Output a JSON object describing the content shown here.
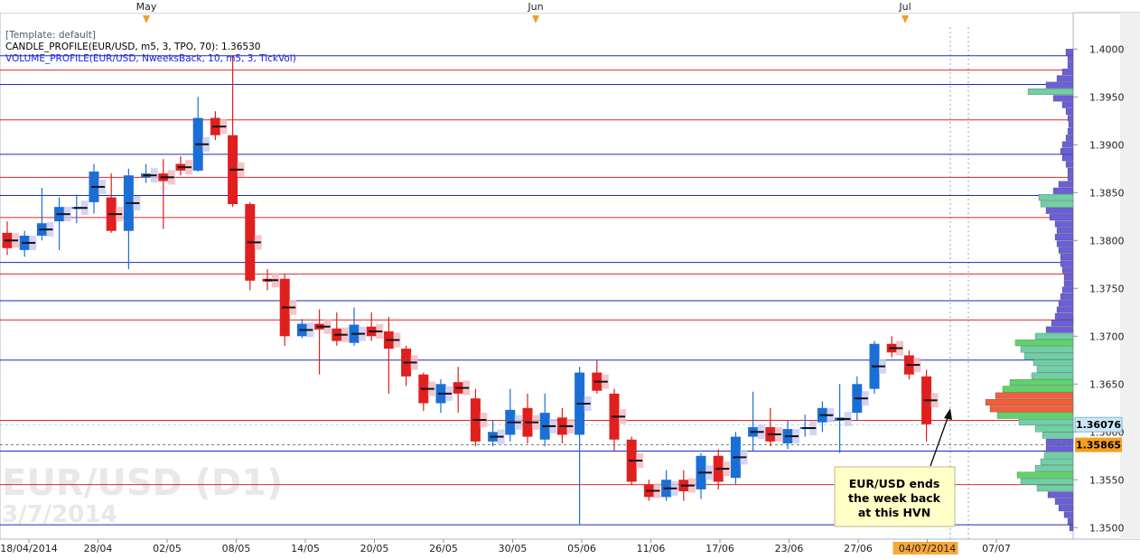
{
  "chart_data": {
    "type": "candlestick",
    "symbol_watermark": "EUR/USD (D1)",
    "date_watermark": "3/7/2014",
    "template_label": "[Template: default]",
    "indicator_1": "CANDLE_PROFILE(EUR/USD, m5, 3, TPO, 70): 1.36530",
    "indicator_2": "VOLUME_PROFILE(EUR/USD, NweeksBack, 10, m5, 3, TickVol)",
    "ylim": [
      1.3488,
      1.4038
    ],
    "y_ticks": [
      "1.4000",
      "1.3950",
      "1.3900",
      "1.3850",
      "1.3800",
      "1.3750",
      "1.3700",
      "1.3650",
      "1.3600",
      "1.3550",
      "1.3500"
    ],
    "months": [
      "May",
      "Jun",
      "Jul"
    ],
    "x_labels": [
      "18/04/2014",
      "28/04",
      "02/05",
      "08/05",
      "14/05",
      "20/05",
      "26/05",
      "30/05",
      "05/06",
      "11/06",
      "17/06",
      "23/06",
      "27/06",
      "04/07/2014",
      "07/07"
    ],
    "current_price": "1.36076",
    "marker_price": "1.35865",
    "current_price_value": 1.36076,
    "marker_price_value": 1.35865,
    "red_levels": [
      1.3978,
      1.3926,
      1.3866,
      1.3824,
      1.3765,
      1.3717,
      1.3612,
      1.3545
    ],
    "blue_levels": [
      1.3993,
      1.3963,
      1.389,
      1.3847,
      1.3777,
      1.3737,
      1.3675,
      1.358,
      1.3503
    ],
    "candles": [
      {
        "o": 1.3808,
        "h": 1.382,
        "l": 1.3785,
        "c": 1.3792
      },
      {
        "o": 1.379,
        "h": 1.381,
        "l": 1.3783,
        "c": 1.3805
      },
      {
        "o": 1.3805,
        "h": 1.3855,
        "l": 1.38,
        "c": 1.3818
      },
      {
        "o": 1.382,
        "h": 1.3845,
        "l": 1.379,
        "c": 1.3835
      },
      {
        "o": 1.3833,
        "h": 1.3848,
        "l": 1.3818,
        "c": 1.3835
      },
      {
        "o": 1.384,
        "h": 1.388,
        "l": 1.3828,
        "c": 1.3872
      },
      {
        "o": 1.3845,
        "h": 1.387,
        "l": 1.3808,
        "c": 1.381
      },
      {
        "o": 1.381,
        "h": 1.3875,
        "l": 1.377,
        "c": 1.3868
      },
      {
        "o": 1.3866,
        "h": 1.388,
        "l": 1.386,
        "c": 1.387
      },
      {
        "o": 1.387,
        "h": 1.3885,
        "l": 1.3812,
        "c": 1.3862
      },
      {
        "o": 1.388,
        "h": 1.3888,
        "l": 1.3868,
        "c": 1.3873
      },
      {
        "o": 1.3873,
        "h": 1.395,
        "l": 1.3872,
        "c": 1.3928
      },
      {
        "o": 1.3928,
        "h": 1.3935,
        "l": 1.3905,
        "c": 1.391
      },
      {
        "o": 1.391,
        "h": 1.3993,
        "l": 1.3835,
        "c": 1.3838
      },
      {
        "o": 1.3838,
        "h": 1.384,
        "l": 1.3748,
        "c": 1.3758
      },
      {
        "o": 1.376,
        "h": 1.377,
        "l": 1.3748,
        "c": 1.3757
      },
      {
        "o": 1.376,
        "h": 1.3765,
        "l": 1.369,
        "c": 1.37
      },
      {
        "o": 1.37,
        "h": 1.3718,
        "l": 1.3698,
        "c": 1.3713
      },
      {
        "o": 1.3713,
        "h": 1.3728,
        "l": 1.366,
        "c": 1.3707
      },
      {
        "o": 1.3708,
        "h": 1.3725,
        "l": 1.369,
        "c": 1.3695
      },
      {
        "o": 1.3693,
        "h": 1.373,
        "l": 1.369,
        "c": 1.3712
      },
      {
        "o": 1.371,
        "h": 1.3725,
        "l": 1.3695,
        "c": 1.37
      },
      {
        "o": 1.3705,
        "h": 1.372,
        "l": 1.364,
        "c": 1.3687
      },
      {
        "o": 1.3687,
        "h": 1.369,
        "l": 1.3648,
        "c": 1.3658
      },
      {
        "o": 1.366,
        "h": 1.3662,
        "l": 1.3622,
        "c": 1.363
      },
      {
        "o": 1.363,
        "h": 1.3655,
        "l": 1.362,
        "c": 1.365
      },
      {
        "o": 1.3652,
        "h": 1.3668,
        "l": 1.362,
        "c": 1.364
      },
      {
        "o": 1.3635,
        "h": 1.3645,
        "l": 1.3585,
        "c": 1.359
      },
      {
        "o": 1.359,
        "h": 1.3612,
        "l": 1.3585,
        "c": 1.36
      },
      {
        "o": 1.3597,
        "h": 1.3645,
        "l": 1.359,
        "c": 1.3623
      },
      {
        "o": 1.3625,
        "h": 1.364,
        "l": 1.3588,
        "c": 1.3595
      },
      {
        "o": 1.3592,
        "h": 1.364,
        "l": 1.3585,
        "c": 1.362
      },
      {
        "o": 1.3615,
        "h": 1.3625,
        "l": 1.3588,
        "c": 1.3597
      },
      {
        "o": 1.3597,
        "h": 1.3668,
        "l": 1.3503,
        "c": 1.3662
      },
      {
        "o": 1.3662,
        "h": 1.3675,
        "l": 1.364,
        "c": 1.3643
      },
      {
        "o": 1.364,
        "h": 1.3645,
        "l": 1.358,
        "c": 1.3592
      },
      {
        "o": 1.3592,
        "h": 1.3595,
        "l": 1.3545,
        "c": 1.3548
      },
      {
        "o": 1.3545,
        "h": 1.355,
        "l": 1.3528,
        "c": 1.3532
      },
      {
        "o": 1.3532,
        "h": 1.356,
        "l": 1.3528,
        "c": 1.355
      },
      {
        "o": 1.355,
        "h": 1.356,
        "l": 1.3528,
        "c": 1.3538
      },
      {
        "o": 1.354,
        "h": 1.3578,
        "l": 1.353,
        "c": 1.3575
      },
      {
        "o": 1.3575,
        "h": 1.3582,
        "l": 1.354,
        "c": 1.3548
      },
      {
        "o": 1.3552,
        "h": 1.36,
        "l": 1.3545,
        "c": 1.3595
      },
      {
        "o": 1.3595,
        "h": 1.3642,
        "l": 1.358,
        "c": 1.3605
      },
      {
        "o": 1.3605,
        "h": 1.3625,
        "l": 1.3585,
        "c": 1.359
      },
      {
        "o": 1.3588,
        "h": 1.3612,
        "l": 1.3582,
        "c": 1.3603
      },
      {
        "o": 1.3603,
        "h": 1.3618,
        "l": 1.3595,
        "c": 1.3605
      },
      {
        "o": 1.361,
        "h": 1.3632,
        "l": 1.36,
        "c": 1.3625
      },
      {
        "o": 1.3612,
        "h": 1.365,
        "l": 1.3578,
        "c": 1.3615
      },
      {
        "o": 1.362,
        "h": 1.3658,
        "l": 1.3612,
        "c": 1.365
      },
      {
        "o": 1.3645,
        "h": 1.3695,
        "l": 1.364,
        "c": 1.3692
      },
      {
        "o": 1.3692,
        "h": 1.37,
        "l": 1.3678,
        "c": 1.3683
      },
      {
        "o": 1.368,
        "h": 1.3685,
        "l": 1.3655,
        "c": 1.366
      },
      {
        "o": 1.3658,
        "h": 1.3665,
        "l": 1.359,
        "c": 1.3608
      }
    ],
    "volume_profile": [
      0.08,
      0.06,
      0.06,
      0.12,
      0.18,
      0.3,
      0.5,
      0.22,
      0.12,
      0.08,
      0.06,
      0.05,
      0.06,
      0.08,
      0.12,
      0.14,
      0.12,
      0.08,
      0.06,
      0.06,
      0.16,
      0.22,
      0.38,
      0.36,
      0.3,
      0.26,
      0.2,
      0.18,
      0.2,
      0.18,
      0.16,
      0.14,
      0.14,
      0.12,
      0.1,
      0.1,
      0.12,
      0.14,
      0.16,
      0.18,
      0.2,
      0.24,
      0.3,
      0.42,
      0.64,
      0.58,
      0.54,
      0.44,
      0.4,
      0.46,
      0.7,
      0.78,
      0.86,
      0.97,
      0.92,
      0.84,
      0.6,
      0.42,
      0.34,
      0.3,
      0.3,
      0.32,
      0.36,
      0.42,
      0.62,
      0.58,
      0.4,
      0.28,
      0.2,
      0.16,
      0.1,
      0.06,
      0.04
    ],
    "annotation": [
      "EUR/USD ends",
      "the week back",
      "at this HVN"
    ]
  }
}
